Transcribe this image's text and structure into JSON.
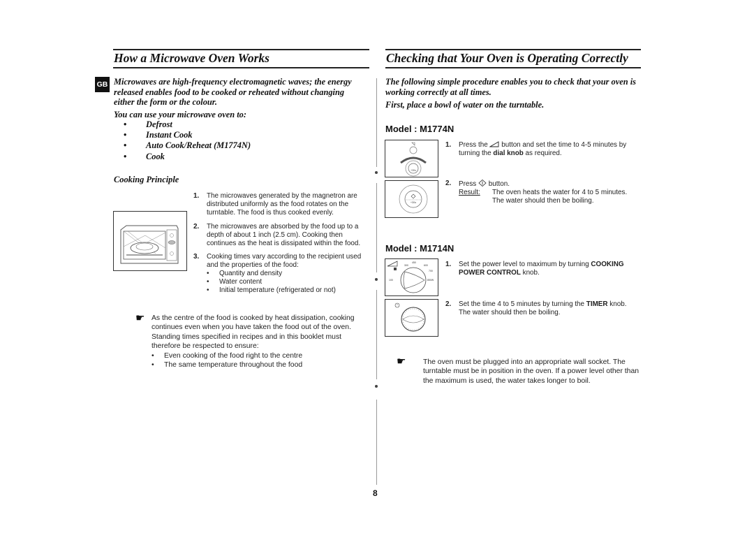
{
  "language_tab": "GB",
  "page_number": "8",
  "left": {
    "title": "How a Microwave Oven Works",
    "intro": "Microwaves are high-frequency electromagnetic waves; the energy released enables food to be cooked or reheated without changing either the form or the colour.",
    "uses_heading": "You can use your microwave oven to:",
    "uses": [
      "Defrost",
      "Instant Cook",
      "Auto Cook/Reheat (M1774N)",
      "Cook"
    ],
    "principle_heading": "Cooking Principle",
    "steps": [
      {
        "num": "1.",
        "text": "The microwaves generated by the magnetron are distributed uniformly as the food rotates on the turntable. The food is thus cooked evenly."
      },
      {
        "num": "2.",
        "text": "The microwaves are absorbed by the food up to a depth of about 1 inch (2.5 cm). Cooking then continues as the heat is dissipated within the food."
      },
      {
        "num": "3.",
        "text": "Cooking times vary according to the recipient used and the properties of the food:",
        "sub": [
          "Quantity and density",
          "Water content",
          "Initial temperature (refrigerated or not)"
        ]
      }
    ],
    "note": {
      "icon": "pointing-hand-icon",
      "text": "As the centre of the food is cooked by heat dissipation, cooking continues even when you have taken the food out of the oven. Standing times specified in recipes and in this booklet must therefore be respected to ensure:",
      "sub": [
        "Even cooking of the food right to the centre",
        "The same temperature throughout the food"
      ]
    },
    "figure_name": "microwave-oven-illustration"
  },
  "right": {
    "title": "Checking that Your Oven is Operating Correctly",
    "intro": "The following simple procedure enables you to check that your oven is working correctly at all times.",
    "intro2": "First, place a bowl of water on the turntable.",
    "models": [
      {
        "label": "Model : M1774N",
        "steps": [
          {
            "num": "1.",
            "pre": "Press the",
            "icon": "power-triangle-icon",
            "mid": "button and set the time to 4-5 minutes by turning the",
            "bold": "dial knob",
            "post": "as required."
          },
          {
            "num": "2.",
            "pre": "Press",
            "icon": "start-button-icon",
            "post": "button.",
            "result_label": "Result:",
            "result_lines": [
              "The oven heats the water for 4 to 5 minutes.",
              "The water should then be boiling."
            ]
          }
        ],
        "dial_label": "+30s"
      },
      {
        "label": "Model : M1714N",
        "steps": [
          {
            "num": "1.",
            "pre": "Set the power level to maximum by turning",
            "bold": "COOKING POWER CONTROL",
            "post": "knob."
          },
          {
            "num": "2.",
            "pre": "Set the time 4 to 5 minutes by turning the",
            "bold": "TIMER",
            "post": "knob.",
            "line2": "The water should then be boiling."
          }
        ],
        "power_dial_labels": [
          "300",
          "450",
          "600",
          "700",
          "100",
          "850W"
        ]
      }
    ],
    "note": {
      "icon": "pointing-hand-icon",
      "text": "The oven must be plugged into an appropriate wall socket. The turntable must be in position in the oven. If a power level other than the maximum is used, the water takes longer to boil."
    }
  }
}
